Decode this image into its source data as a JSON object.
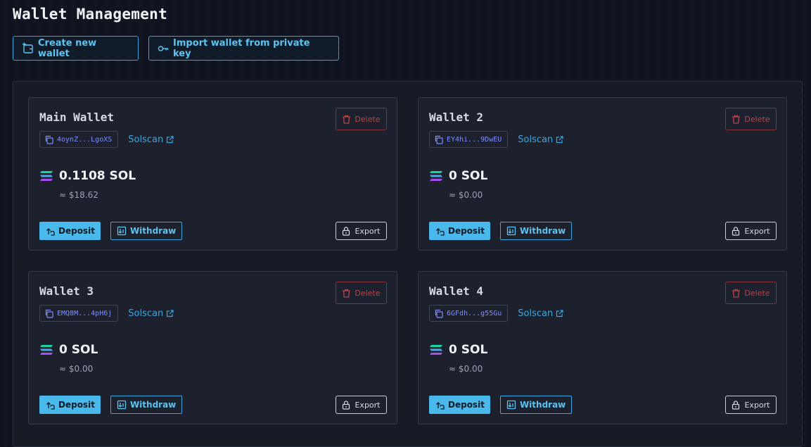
{
  "page": {
    "title": "Wallet Management"
  },
  "toolbar": {
    "create_label": "Create new wallet",
    "import_label": "Import wallet from private key"
  },
  "labels": {
    "delete": "Delete",
    "solscan": "Solscan",
    "deposit": "Deposit",
    "withdraw": "Withdraw",
    "export": "Export"
  },
  "wallets": [
    {
      "name": "Main Wallet",
      "address": "4oynZ...LgoXS",
      "balance": "0.1108 SOL",
      "usd": "≈ $18.62"
    },
    {
      "name": "Wallet 2",
      "address": "EY4hi...9DwEU",
      "balance": "0 SOL",
      "usd": "≈ $0.00"
    },
    {
      "name": "Wallet 3",
      "address": "EMQ8M...4pH6j",
      "balance": "0 SOL",
      "usd": "≈ $0.00"
    },
    {
      "name": "Wallet 4",
      "address": "6GFdh...g55Gu",
      "balance": "0 SOL",
      "usd": "≈ $0.00"
    }
  ],
  "colors": {
    "accent": "#49b8ea",
    "delete": "#b9444b",
    "address": "#7f8cff",
    "background": "#0f1420"
  }
}
